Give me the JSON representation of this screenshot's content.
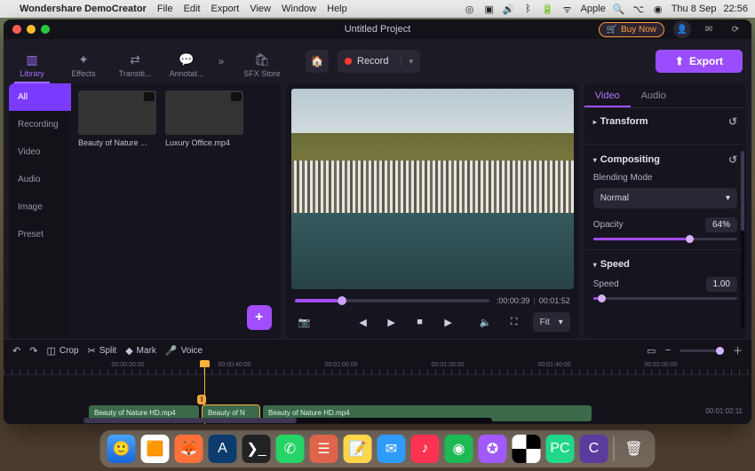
{
  "menubar": {
    "app": "Wondershare DemoCreator",
    "items": [
      "File",
      "Edit",
      "Export",
      "View",
      "Window",
      "Help"
    ],
    "right": {
      "brand": "Apple",
      "date": "Thu 8 Sep",
      "time": "22:56"
    }
  },
  "window": {
    "title": "Untitled Project",
    "buy": "Buy Now",
    "export": "Export"
  },
  "topTabs": {
    "items": [
      "Library",
      "Effects",
      "Transiti...",
      "Annotat..."
    ],
    "sfx": "SFX Store"
  },
  "homebar": {
    "record": "Record"
  },
  "library": {
    "cats": [
      "All",
      "Recording",
      "Video",
      "Audio",
      "Image",
      "Preset"
    ],
    "thumbs": [
      {
        "caption": "Beauty of Nature ..."
      },
      {
        "caption": "Luxury Office.mp4"
      }
    ]
  },
  "preview": {
    "cur": ":00:00:39",
    "dur": "00:01:52",
    "fit": "Fit"
  },
  "props": {
    "tabs": [
      "Video",
      "Audio"
    ],
    "transform": "Transform",
    "compositing": "Compositing",
    "blend_label": "Blending Mode",
    "blend_value": "Normal",
    "opacity_label": "Opacity",
    "opacity_value": "64%",
    "speed": "Speed",
    "speed_label": "Speed",
    "speed_value": "1.00"
  },
  "tl": {
    "tools": {
      "crop": "Crop",
      "split": "Split",
      "mark": "Mark",
      "voice": "Voice"
    },
    "ruler": [
      "00:00:20:00",
      "00:00:40:00",
      "00:01:00:00",
      "00:01:20:00",
      "00:01:40:00",
      "00:02:00:00"
    ],
    "clips": [
      "Beauty of Nature HD.mp4",
      "Beauty of N",
      "Beauty of Nature HD.mp4"
    ],
    "endtime": "00:01:02:11",
    "marker": "I"
  }
}
